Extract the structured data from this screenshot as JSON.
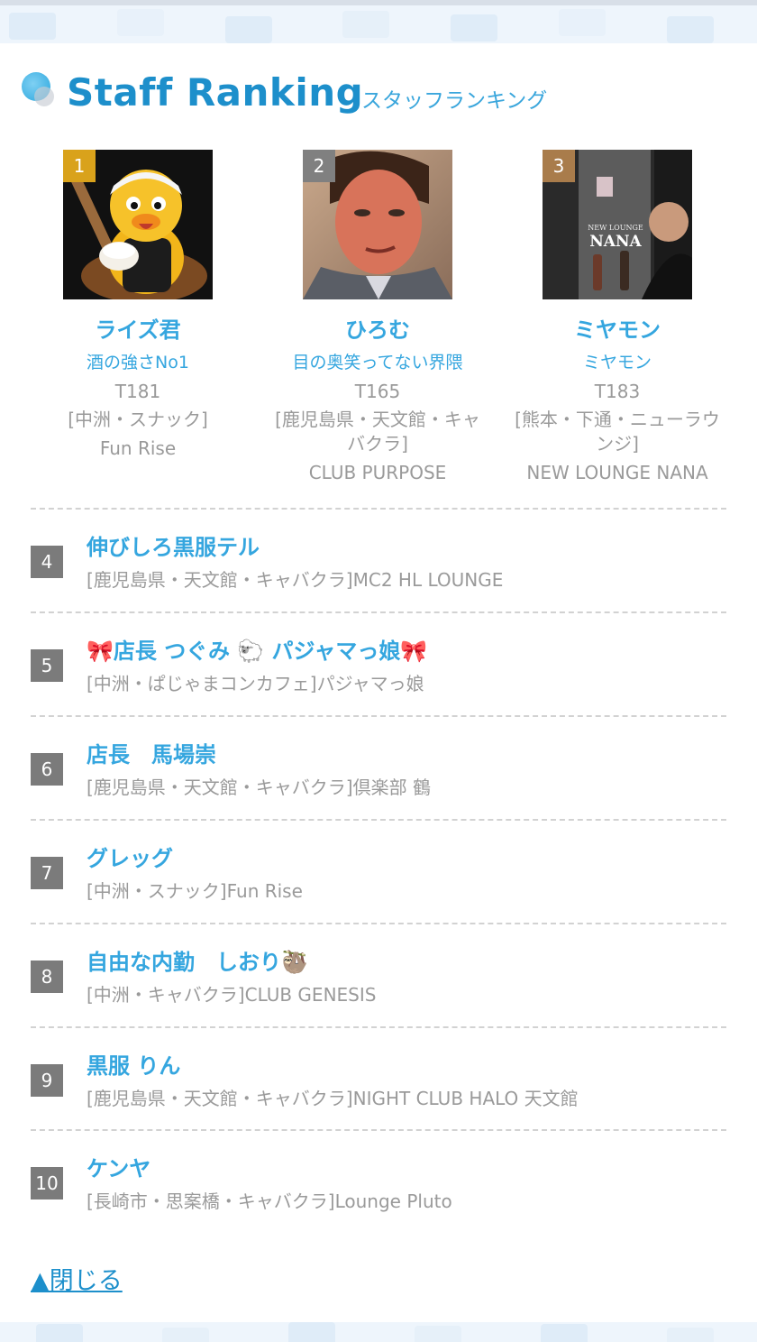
{
  "header": {
    "title_en": "Staff Ranking",
    "title_jp": "スタッフランキング"
  },
  "top3": [
    {
      "rank": "1",
      "name": "ライズ君",
      "catch": "酒の強さNo1",
      "height": "T181",
      "area": "[中洲・スナック]",
      "shop": "Fun Rise",
      "badge_color": "#d9a21b",
      "photo_icon": "mascot-photo"
    },
    {
      "rank": "2",
      "name": "ひろむ",
      "catch": "目の奥笑ってない界隈",
      "height": "T165",
      "area": "[鹿児島県・天文館・キャバクラ]",
      "shop": "CLUB PURPOSE",
      "badge_color": "#808080",
      "photo_icon": "staff-photo"
    },
    {
      "rank": "3",
      "name": "ミヤモン",
      "catch": "ミヤモン",
      "height": "T183",
      "area": "[熊本・下通・ニューラウンジ]",
      "shop": "NEW LOUNGE NANA",
      "badge_color": "#a97c4b",
      "photo_icon": "staff-photo",
      "photo_sign_small": "NEW LOUNGE",
      "photo_sign": "NANA"
    }
  ],
  "list": [
    {
      "rank": "4",
      "name": "伸びしろ黒服テル",
      "sub": "[鹿児島県・天文館・キャバクラ]MC2 HL LOUNGE"
    },
    {
      "rank": "5",
      "name": "🎀店長 つぐみ 🐑 パジャマっ娘🎀",
      "sub": "[中洲・ぱじゃまコンカフェ]パジャマっ娘"
    },
    {
      "rank": "6",
      "name": "店長　馬場崇",
      "sub": "[鹿児島県・天文館・キャバクラ]倶楽部 鶴"
    },
    {
      "rank": "7",
      "name": "グレッグ",
      "sub": "[中洲・スナック]Fun Rise"
    },
    {
      "rank": "8",
      "name": "自由な内勤　しおり🦥",
      "sub": "[中洲・キャバクラ]CLUB GENESIS"
    },
    {
      "rank": "9",
      "name": "黒服 りん",
      "sub": "[鹿児島県・天文館・キャバクラ]NIGHT CLUB HALO 天文館"
    },
    {
      "rank": "10",
      "name": "ケンヤ",
      "sub": "[長崎市・思案橋・キャバクラ]Lounge Pluto"
    }
  ],
  "close_label": "▲閉じる",
  "colors": {
    "accent": "#1d8fcb",
    "name": "#35a6df",
    "muted": "#9a9a9a",
    "rank_box": "#7b7b7b"
  }
}
